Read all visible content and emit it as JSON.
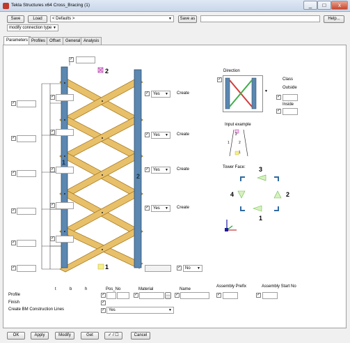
{
  "window": {
    "title": "Tekla Structures x64  Cross_Bracing (1)",
    "minimize": "_",
    "maximize": "□",
    "close": "x"
  },
  "toolbar": {
    "save": "Save",
    "load": "Load",
    "preset": "< Defaults >",
    "save_as": "Save as",
    "help": "Help..."
  },
  "mode": {
    "value": "modify connection type"
  },
  "tabs": [
    "Parameters",
    "Profiles",
    "Offset",
    "General",
    "Analysis"
  ],
  "side": {
    "yes": "Yes",
    "create": "Create",
    "no": "No"
  },
  "direction": {
    "title": "Direction",
    "class_label": "Class",
    "outside": "Outside",
    "inside": "Inside"
  },
  "input_example": {
    "title": "Input example",
    "nums": [
      "2",
      "1",
      "2",
      "1"
    ]
  },
  "tower": {
    "title": "Tower Face:",
    "n1": "1",
    "n2": "2",
    "n3": "3",
    "n4": "4"
  },
  "drawing": {
    "label1": "1",
    "label2": "2",
    "brace1": "1",
    "brace2": "2"
  },
  "props": {
    "headers": {
      "t": "t",
      "b": "b",
      "h": "h",
      "pos_no": "Pos_No",
      "material": "Material",
      "name": "Name",
      "prefix": "Assembly Prefix",
      "start_no": "Assembly Start No"
    },
    "profile": "Profile",
    "finish": "Finish",
    "bm_lines": "Create BM Construction Lines",
    "bm_value": "Yes",
    "dots": "..."
  },
  "bottom": {
    "ok": "OK",
    "apply": "Apply",
    "modify": "Modify",
    "get": "Get",
    "toggle": "✓ / ☐",
    "cancel": "Cancel"
  },
  "colors": {
    "column": "#5b87b0",
    "brace": "#e8c06a",
    "brace_edge": "#a87a20",
    "title_bg": "#dfe8f4",
    "active_tab": "#ffffff"
  }
}
